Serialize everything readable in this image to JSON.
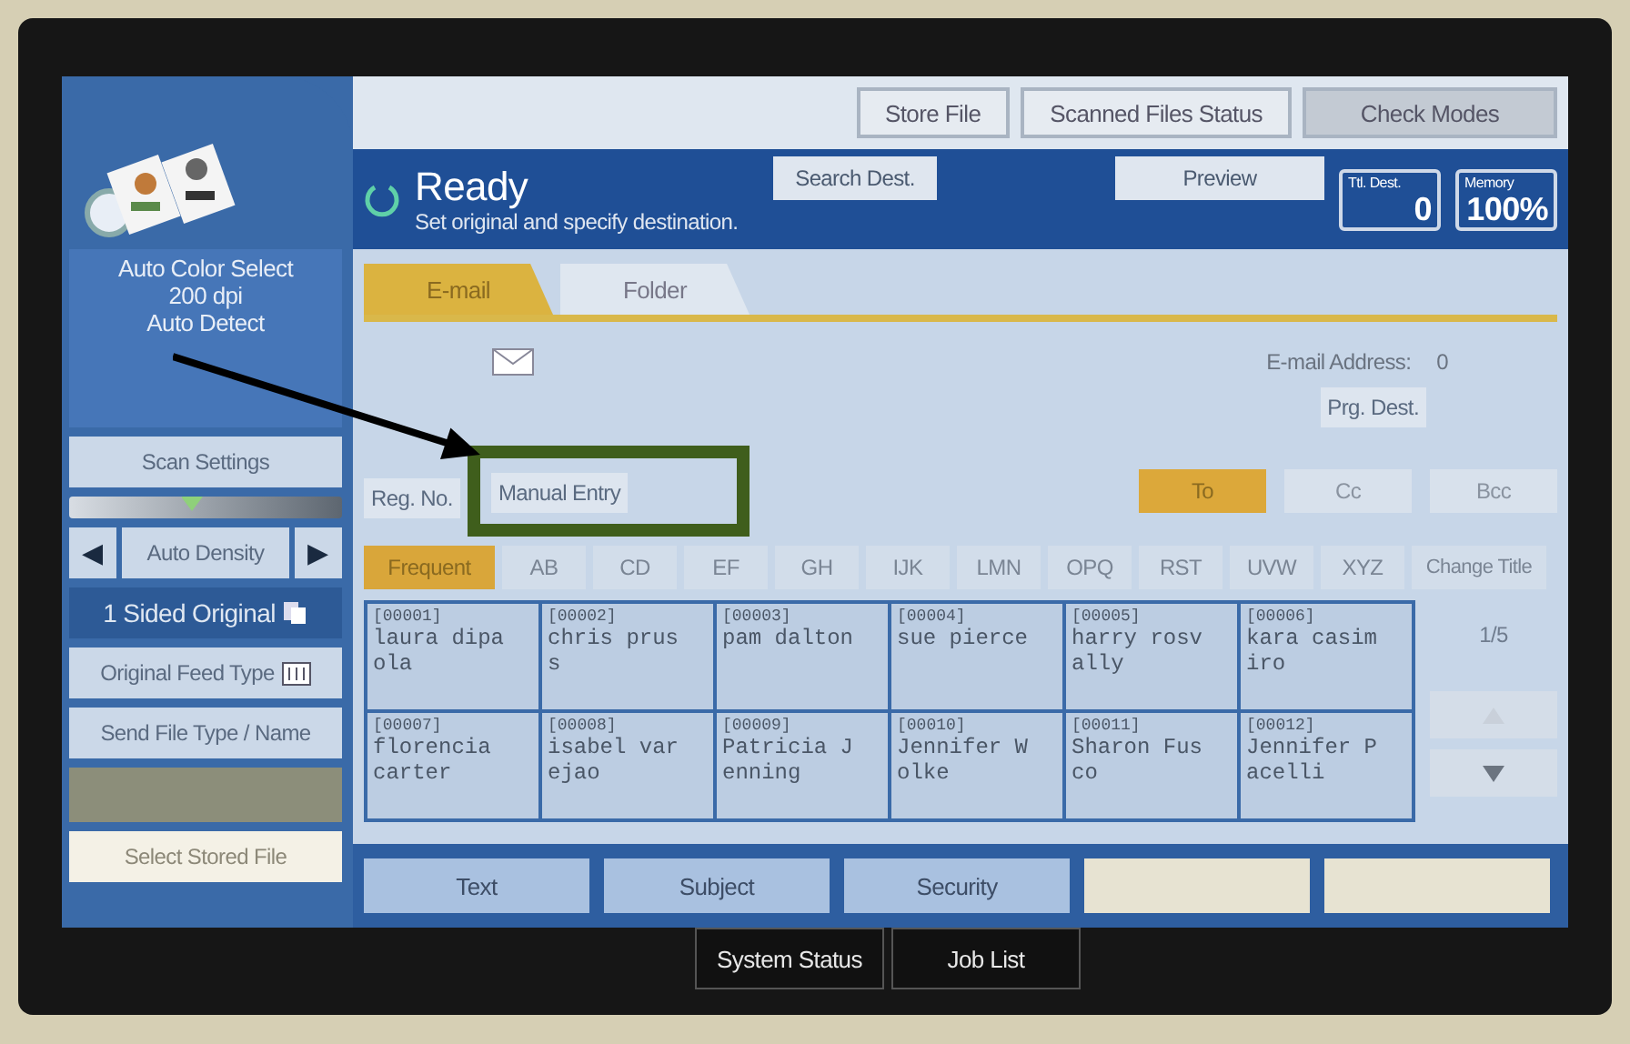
{
  "top_buttons": [
    {
      "label": "Store File"
    },
    {
      "label": "Scanned Files Status"
    },
    {
      "label": "Check Modes"
    }
  ],
  "status": {
    "title": "Ready",
    "message": "Set original and specify destination."
  },
  "header_buttons": [
    {
      "label": "Search Dest."
    },
    {
      "label": "Preview"
    }
  ],
  "counters": [
    {
      "label": "Ttl. Dest.",
      "value": "0"
    },
    {
      "label": "Memory",
      "value": "100%"
    }
  ],
  "scan_info": [
    "Auto Color Select",
    "200 dpi",
    "Auto Detect"
  ],
  "scan_settings": "Scan Settings",
  "density": {
    "level": 0.45,
    "left": "◀",
    "label": "Auto Density",
    "right": "▶"
  },
  "original": "1 Sided Original",
  "feed_type": "Original Feed Type",
  "send_file_type": "Send File Type / Name",
  "stored_file": "Select Stored File",
  "tabs": [
    {
      "label": "E-mail",
      "selected": true
    },
    {
      "label": "Folder",
      "selected": false
    }
  ],
  "address_count": {
    "label": "E-mail Address:",
    "value": "0"
  },
  "prg_dest": "Prg. Dest.",
  "entry_buttons": [
    {
      "label": "Reg. No."
    },
    {
      "label": "Manual Entry"
    }
  ],
  "recipient_types": [
    {
      "label": "To",
      "selected": true
    },
    {
      "label": "Cc",
      "selected": false
    },
    {
      "label": "Bcc",
      "selected": false
    }
  ],
  "index_tabs": [
    {
      "label": "Frequent",
      "selected": true
    },
    {
      "label": "AB",
      "selected": false
    },
    {
      "label": "CD",
      "selected": false
    },
    {
      "label": "EF",
      "selected": false
    },
    {
      "label": "GH",
      "selected": false
    },
    {
      "label": "IJK",
      "selected": false
    },
    {
      "label": "LMN",
      "selected": false
    },
    {
      "label": "OPQ",
      "selected": false
    },
    {
      "label": "RST",
      "selected": false
    },
    {
      "label": "UVW",
      "selected": false
    },
    {
      "label": "XYZ",
      "selected": false
    }
  ],
  "change_title": "Change Title",
  "destinations": [
    {
      "code": "[00001]",
      "name": "laura dipaola"
    },
    {
      "code": "[00002]",
      "name": "chris pruss"
    },
    {
      "code": "[00003]",
      "name": "pam dalton"
    },
    {
      "code": "[00004]",
      "name": "sue pierce"
    },
    {
      "code": "[00005]",
      "name": "harry rosvally"
    },
    {
      "code": "[00006]",
      "name": "kara casimiro"
    },
    {
      "code": "[00007]",
      "name": "florencia carter"
    },
    {
      "code": "[00008]",
      "name": "isabel varejao"
    },
    {
      "code": "[00009]",
      "name": "Patricia Jenning"
    },
    {
      "code": "[00010]",
      "name": "Jennifer Wolke"
    },
    {
      "code": "[00011]",
      "name": "Sharon Fusco"
    },
    {
      "code": "[00012]",
      "name": "Jennifer Pacelli"
    }
  ],
  "page": "1/5",
  "bottom_buttons": [
    {
      "label": "Text"
    },
    {
      "label": "Subject"
    },
    {
      "label": "Security"
    }
  ],
  "footer_buttons": [
    {
      "label": "System Status"
    },
    {
      "label": "Job List"
    }
  ]
}
